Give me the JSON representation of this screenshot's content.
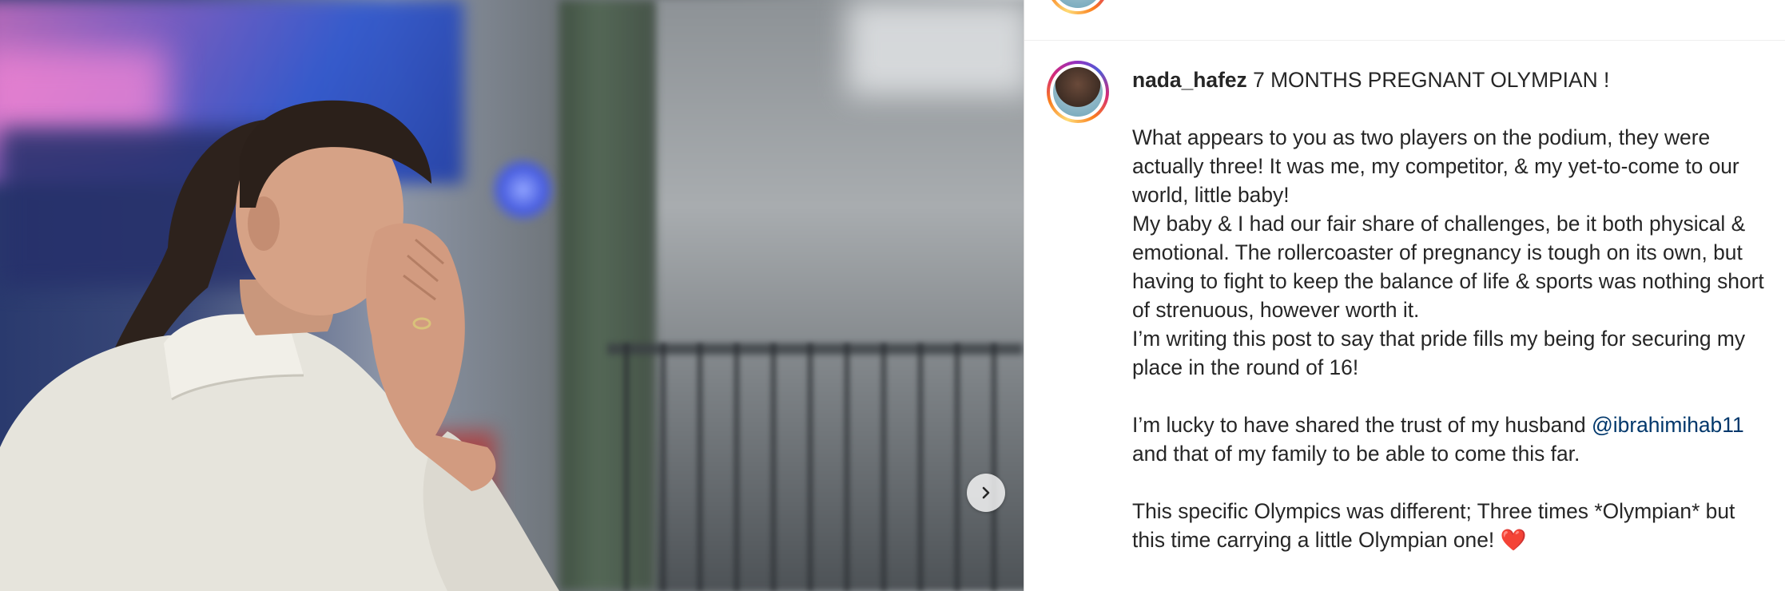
{
  "post": {
    "author": {
      "username": "nada_hafez",
      "avatar": "profile-photo"
    },
    "caption": {
      "headline": " 7 MONTHS PREGNANT OLYMPIAN !",
      "para1": "What appears to you as two players on the podium, they were actually three! It was me, my competitor, & my yet-to-come to our world, little baby!",
      "para2": "My baby & I had our fair share of challenges, be it both physical & emotional. The rollercoaster of pregnancy is tough on its own, but having to fight to keep the balance of life & sports was nothing short of strenuous, however worth it.",
      "para3": "I’m writing this post to say that pride fills my being for securing my place in the round of 16!",
      "para4_before": "I’m lucky to have shared the trust of my husband ",
      "mention": "@ibrahimihab11",
      "para4_after": " and that of my family to be able to come this far.",
      "para5": "This specific Olympics was different; Three times *Olympian* but this time carrying a little Olympian one! ",
      "heart": "❤️"
    },
    "media": {
      "next_button_icon": "chevron-right-icon"
    }
  },
  "colors": {
    "text": "#262626",
    "mention": "#00376b",
    "divider": "#dbdbdb",
    "heart": "#e0181b"
  }
}
